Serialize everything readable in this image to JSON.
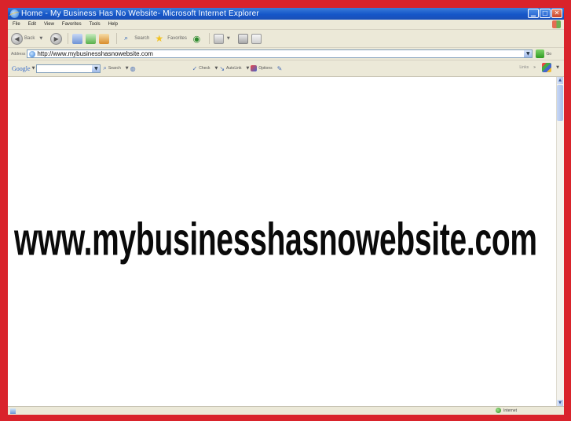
{
  "window": {
    "title": "Home - My Business Has No Website- Microsoft Internet Explorer"
  },
  "menu": [
    "File",
    "Edit",
    "View",
    "Favorites",
    "Tools",
    "Help"
  ],
  "toolbar": {
    "back_label": "Back",
    "search_label": "Search",
    "favorites_label": "Favorites"
  },
  "address": {
    "label": "Address",
    "url": "http://www.mybusinesshasnowebsite.com",
    "go_label": "Go"
  },
  "google_toolbar": {
    "logo": "Google",
    "search_label": "Search",
    "check_label": "Check",
    "autolink_label": "AutoLink",
    "options_label": "Options",
    "links_label": "Links"
  },
  "content": {
    "headline": "www.mybusinesshasnowebsite.com"
  },
  "status": {
    "zone": "Internet"
  },
  "colors": {
    "outer_frame": "#d9232b",
    "titlebar": "#1557c9",
    "chrome": "#ece9d8"
  }
}
